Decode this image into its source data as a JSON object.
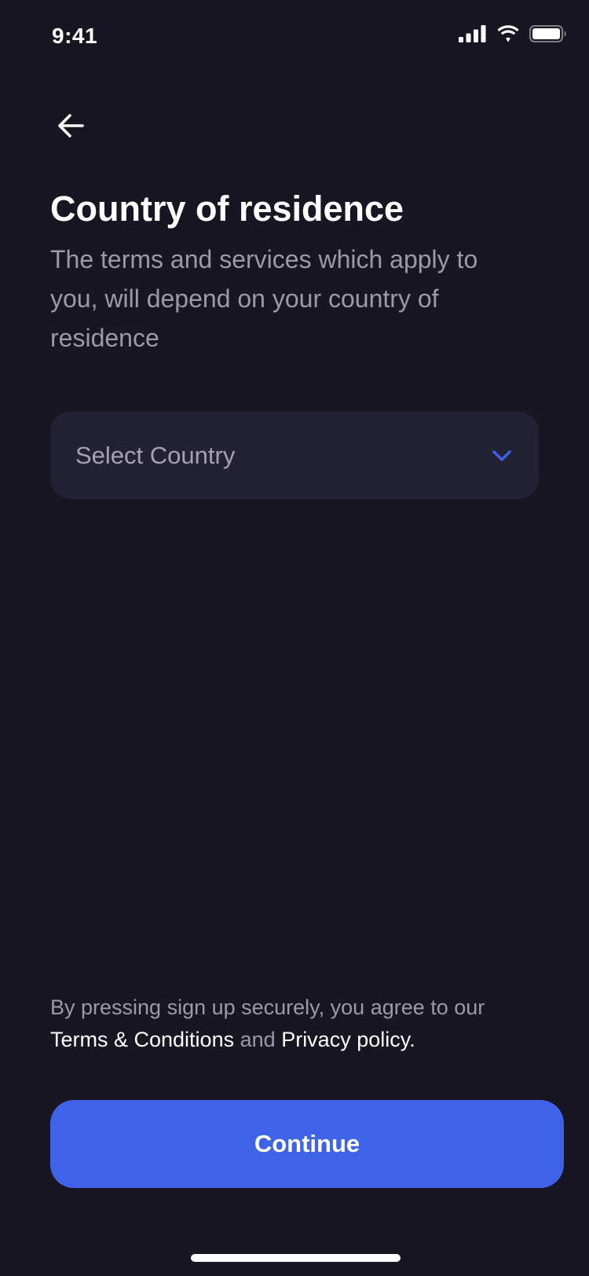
{
  "status_bar": {
    "time": "9:41",
    "icons": [
      "cellular-signal-icon",
      "wifi-icon",
      "battery-icon"
    ]
  },
  "header": {
    "back_icon": "arrow-left-icon",
    "title": "Country of residence",
    "subtitle": "The terms and services which apply to you, will depend on your country of residence"
  },
  "country_select": {
    "placeholder": "Select Country",
    "icon": "chevron-down-icon"
  },
  "terms": {
    "prefix": "By pressing sign up securely, you agree to our",
    "terms_link": "Terms & Conditions",
    "conjunction": "and",
    "privacy_link": "Privacy policy",
    "suffix": "."
  },
  "continue_button": {
    "label": "Continue"
  },
  "colors": {
    "background": "#171622",
    "field_background": "#222135",
    "accent": "#3e63e8",
    "muted_text": "#9c9aa8",
    "primary_text": "#ffffff"
  }
}
